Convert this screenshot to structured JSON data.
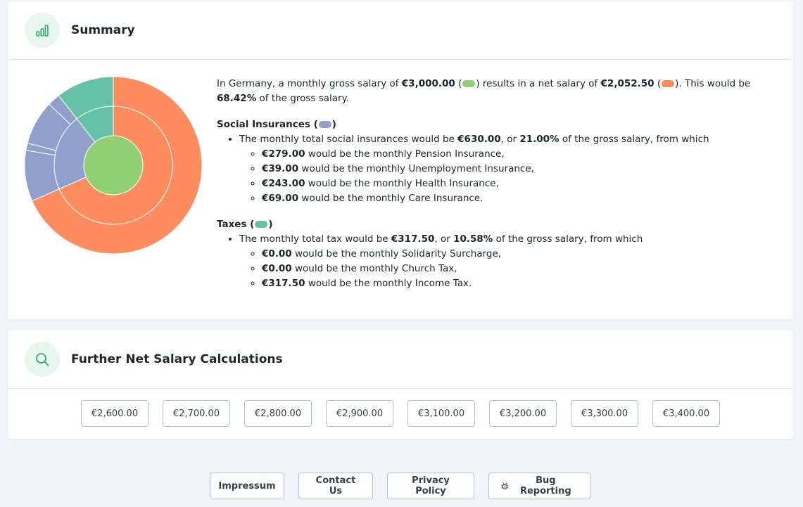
{
  "summary": {
    "title": "Summary",
    "intro_1": "In Germany, a monthly gross salary of ",
    "gross": "€3,000.00",
    "intro_2": " results in a net salary of ",
    "net": "€2,052.50",
    "intro_3": ". This would be ",
    "net_percent": "68.42%",
    "intro_4": " of the gross salary.",
    "social": {
      "title": "Social Insurances",
      "line_1": "The monthly total social insurances would be ",
      "total": "€630.00",
      "line_2": ", or ",
      "percent": "21.00%",
      "line_3": " of the gross salary, from which",
      "items": [
        {
          "amount": "€279.00",
          "text": " would be the monthly Pension Insurance,"
        },
        {
          "amount": "€39.00",
          "text": " would be the monthly Unemployment Insurance,"
        },
        {
          "amount": "€243.00",
          "text": " would be the monthly Health Insurance,"
        },
        {
          "amount": "€69.00",
          "text": " would be the monthly Care Insurance."
        }
      ]
    },
    "taxes": {
      "title": "Taxes",
      "line_1": "The monthly total tax would be ",
      "total": "€317.50",
      "line_2": ", or ",
      "percent": "10.58%",
      "line_3": " of the gross salary, from which",
      "items": [
        {
          "amount": "€0.00",
          "text": " would be the monthly Solidarity Surcharge,"
        },
        {
          "amount": "€0.00",
          "text": " would be the monthly Church Tax,"
        },
        {
          "amount": "€317.50",
          "text": " would be the monthly Income Tax."
        }
      ]
    }
  },
  "colors": {
    "gross": "#90cf72",
    "net": "#ff8c5f",
    "social": "#8ea0cb",
    "taxes": "#66c2a4"
  },
  "chart_data": {
    "type": "pie",
    "inner": [
      {
        "name": "Gross",
        "value": 3000
      }
    ],
    "middle": [
      {
        "name": "Net",
        "value": 2052.5
      },
      {
        "name": "Social Insurances",
        "value": 630
      },
      {
        "name": "Taxes",
        "value": 317.5
      }
    ],
    "outer": [
      {
        "name": "Net",
        "value": 2052.5
      },
      {
        "name": "Pension Insurance",
        "value": 279
      },
      {
        "name": "Unemployment Insurance",
        "value": 39
      },
      {
        "name": "Health Insurance",
        "value": 243
      },
      {
        "name": "Care Insurance",
        "value": 69
      },
      {
        "name": "Solidarity Surcharge",
        "value": 0
      },
      {
        "name": "Church Tax",
        "value": 0
      },
      {
        "name": "Income Tax",
        "value": 317.5
      }
    ]
  },
  "further": {
    "title": "Further Net Salary Calculations",
    "amounts": [
      "€2,600.00",
      "€2,700.00",
      "€2,800.00",
      "€2,900.00",
      "€3,100.00",
      "€3,200.00",
      "€3,300.00",
      "€3,400.00"
    ]
  },
  "footer": {
    "impressum": "Impressum",
    "contact": "Contact Us",
    "privacy": "Privacy Policy",
    "bug": "Bug Reporting"
  }
}
